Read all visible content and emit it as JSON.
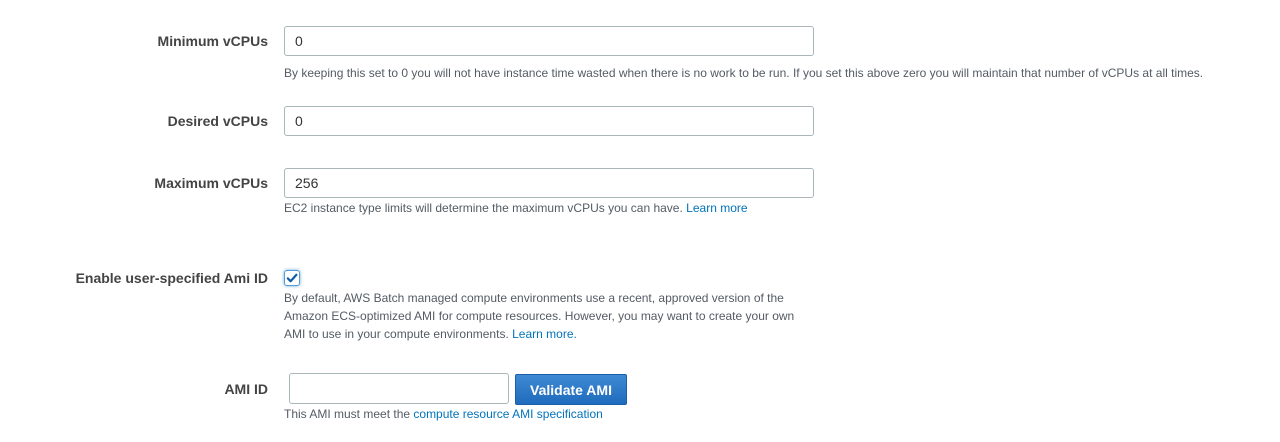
{
  "min_vcpus": {
    "label": "Minimum vCPUs",
    "value": "0",
    "help": "By keeping this set to 0 you will not have instance time wasted when there is no work to be run. If you set this above zero you will maintain that number of vCPUs at all times."
  },
  "desired_vcpus": {
    "label": "Desired vCPUs",
    "value": "0"
  },
  "max_vcpus": {
    "label": "Maximum vCPUs",
    "value": "256",
    "help": "EC2 instance type limits will determine the maximum vCPUs you can have.",
    "help_link": "Learn more"
  },
  "user_ami": {
    "label": "Enable user-specified Ami ID",
    "checked": true,
    "help_line1": "By default, AWS Batch managed compute environments use a recent, approved version of the",
    "help_line2": "Amazon ECS-optimized AMI for compute resources. However, you may want to create your own",
    "help_line3": "AMI to use in your compute environments.",
    "help_link": "Learn more."
  },
  "ami_id": {
    "label": "AMI ID",
    "value": "",
    "button_label": "Validate AMI",
    "help": "This AMI must meet the",
    "help_link": "compute resource AMI specification"
  },
  "colors": {
    "link": "#0073bb",
    "button": "#1f6bbd",
    "label": "#444444"
  }
}
